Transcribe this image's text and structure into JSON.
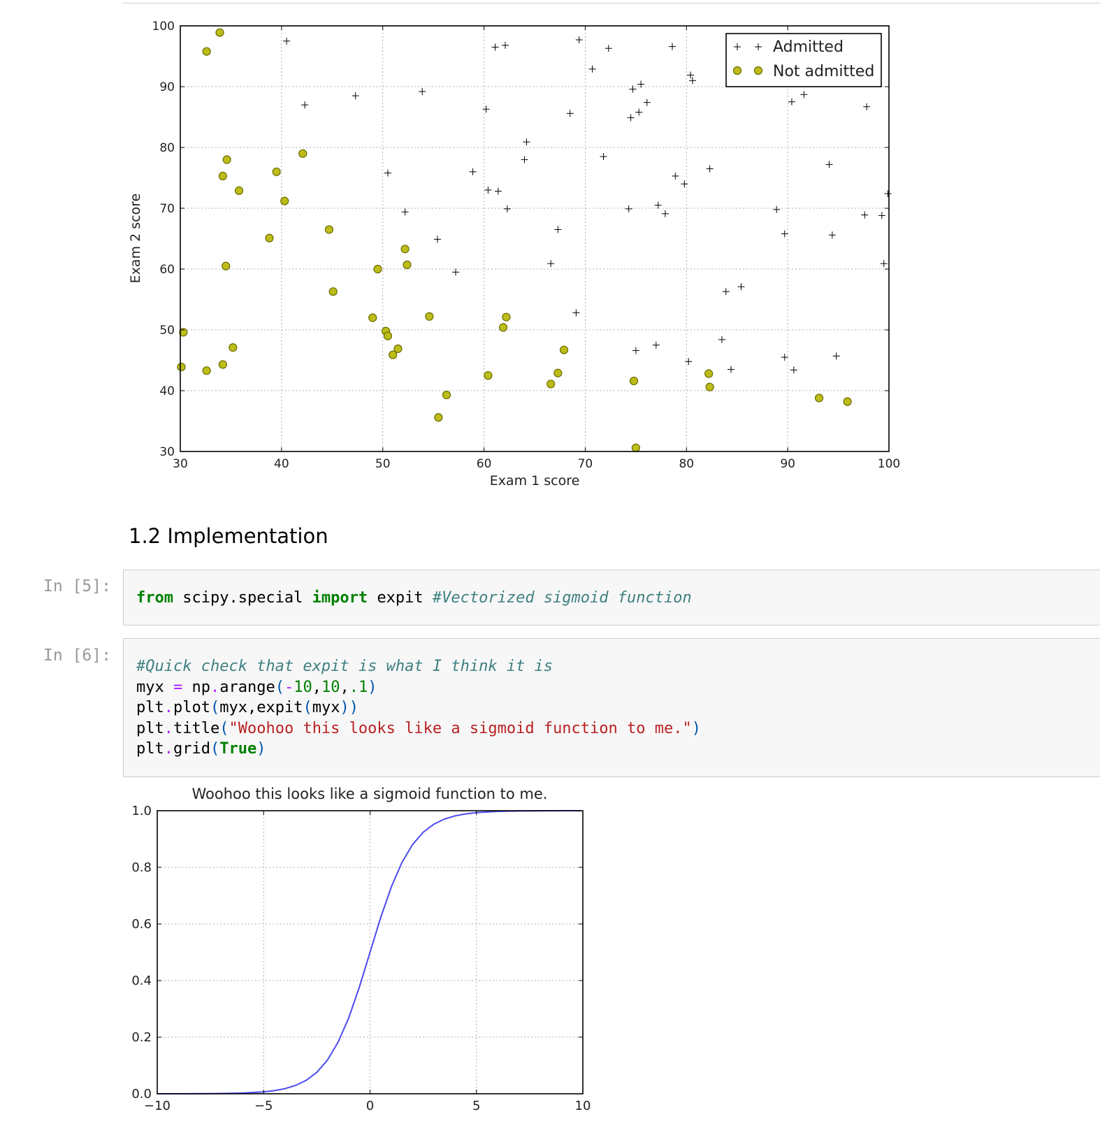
{
  "scatter": {
    "xlabel": "Exam 1 score",
    "ylabel": "Exam 2 score",
    "legend_admitted": "Admitted",
    "legend_not_admitted": "Not admitted",
    "xticks": [
      "30",
      "40",
      "50",
      "60",
      "70",
      "80",
      "90",
      "100"
    ],
    "yticks": [
      "30",
      "40",
      "50",
      "60",
      "70",
      "80",
      "90",
      "100"
    ]
  },
  "heading": "1.2 Implementation",
  "cell5": {
    "prompt": "In [5]:",
    "tokens": [
      {
        "t": "from",
        "c": "kw"
      },
      {
        "t": " scipy.special ",
        "c": ""
      },
      {
        "t": "import",
        "c": "kw"
      },
      {
        "t": " expit ",
        "c": ""
      },
      {
        "t": "#Vectorized sigmoid function",
        "c": "cm"
      }
    ]
  },
  "cell6": {
    "prompt": "In [6]:",
    "lines": [
      [
        {
          "t": "#Quick check that expit is what I think it is",
          "c": "cm"
        }
      ],
      [
        {
          "t": "myx ",
          "c": ""
        },
        {
          "t": "=",
          "c": "op"
        },
        {
          "t": " np",
          "c": ""
        },
        {
          "t": ".",
          "c": "op"
        },
        {
          "t": "arange",
          "c": ""
        },
        {
          "t": "(",
          "c": "par"
        },
        {
          "t": "-",
          "c": "op"
        },
        {
          "t": "10",
          "c": "num"
        },
        {
          "t": ",",
          "c": ""
        },
        {
          "t": "10",
          "c": "num"
        },
        {
          "t": ",",
          "c": ""
        },
        {
          "t": ".1",
          "c": "num"
        },
        {
          "t": ")",
          "c": "par"
        }
      ],
      [
        {
          "t": "plt",
          "c": ""
        },
        {
          "t": ".",
          "c": "op"
        },
        {
          "t": "plot",
          "c": ""
        },
        {
          "t": "(",
          "c": "par"
        },
        {
          "t": "myx,expit",
          "c": ""
        },
        {
          "t": "(",
          "c": "par"
        },
        {
          "t": "myx",
          "c": ""
        },
        {
          "t": "))",
          "c": "par"
        }
      ],
      [
        {
          "t": "plt",
          "c": ""
        },
        {
          "t": ".",
          "c": "op"
        },
        {
          "t": "title",
          "c": ""
        },
        {
          "t": "(",
          "c": "par"
        },
        {
          "t": "\"Woohoo this looks like a sigmoid function to me.\"",
          "c": "str"
        },
        {
          "t": ")",
          "c": "par"
        }
      ],
      [
        {
          "t": "plt",
          "c": ""
        },
        {
          "t": ".",
          "c": "op"
        },
        {
          "t": "grid",
          "c": ""
        },
        {
          "t": "(",
          "c": "par"
        },
        {
          "t": "True",
          "c": "kw"
        },
        {
          "t": ")",
          "c": "par"
        }
      ]
    ]
  },
  "colors": {
    "marker_fill": "#BDBD1A",
    "marker_edge": "#6B6B00",
    "line": "#4A4AF0",
    "grid": "#b0b0b0"
  },
  "chart_data": [
    {
      "type": "scatter",
      "title": "",
      "xlabel": "Exam 1 score",
      "ylabel": "Exam 2 score",
      "xlim": [
        30,
        100
      ],
      "ylim": [
        30,
        100
      ],
      "grid": true,
      "legend": "top-right",
      "series": [
        {
          "name": "Admitted",
          "marker": "plus",
          "points": [
            [
              40.5,
              97.5
            ],
            [
              42.3,
              87.0
            ],
            [
              47.3,
              88.5
            ],
            [
              50.5,
              75.8
            ],
            [
              52.2,
              69.4
            ],
            [
              53.9,
              89.2
            ],
            [
              55.4,
              64.9
            ],
            [
              57.2,
              59.5
            ],
            [
              58.9,
              76.0
            ],
            [
              60.2,
              86.3
            ],
            [
              60.4,
              73.0
            ],
            [
              61.1,
              96.5
            ],
            [
              61.4,
              72.8
            ],
            [
              62.1,
              96.8
            ],
            [
              62.3,
              69.9
            ],
            [
              64.0,
              78.0
            ],
            [
              64.2,
              80.9
            ],
            [
              66.6,
              60.9
            ],
            [
              67.3,
              66.5
            ],
            [
              68.5,
              85.6
            ],
            [
              69.1,
              52.8
            ],
            [
              69.4,
              97.7
            ],
            [
              70.7,
              92.9
            ],
            [
              71.8,
              78.5
            ],
            [
              72.3,
              96.3
            ],
            [
              74.3,
              69.9
            ],
            [
              74.5,
              84.9
            ],
            [
              74.7,
              89.6
            ],
            [
              75.0,
              46.6
            ],
            [
              75.3,
              85.8
            ],
            [
              75.5,
              90.4
            ],
            [
              76.1,
              87.4
            ],
            [
              77.0,
              47.5
            ],
            [
              77.2,
              70.5
            ],
            [
              77.9,
              69.1
            ],
            [
              78.6,
              96.6
            ],
            [
              78.9,
              75.3
            ],
            [
              79.8,
              74.0
            ],
            [
              80.2,
              44.8
            ],
            [
              80.4,
              91.9
            ],
            [
              80.6,
              91.0
            ],
            [
              82.3,
              76.5
            ],
            [
              83.5,
              48.4
            ],
            [
              83.9,
              56.3
            ],
            [
              84.4,
              43.5
            ],
            [
              85.4,
              57.1
            ],
            [
              88.9,
              69.8
            ],
            [
              89.7,
              45.5
            ],
            [
              89.7,
              65.8
            ],
            [
              90.4,
              87.5
            ],
            [
              90.6,
              43.4
            ],
            [
              91.6,
              88.7
            ],
            [
              94.1,
              77.2
            ],
            [
              94.4,
              65.6
            ],
            [
              94.8,
              45.7
            ],
            [
              97.6,
              68.9
            ],
            [
              97.8,
              86.7
            ],
            [
              99.3,
              68.8
            ],
            [
              99.5,
              60.9
            ],
            [
              99.9,
              72.4
            ]
          ]
        },
        {
          "name": "Not admitted",
          "marker": "circle",
          "points": [
            [
              30.1,
              43.9
            ],
            [
              30.3,
              49.6
            ],
            [
              32.6,
              43.3
            ],
            [
              32.6,
              95.8
            ],
            [
              33.9,
              98.9
            ],
            [
              34.2,
              44.3
            ],
            [
              34.2,
              75.3
            ],
            [
              34.5,
              60.5
            ],
            [
              34.6,
              78.0
            ],
            [
              35.2,
              47.1
            ],
            [
              35.8,
              72.9
            ],
            [
              38.8,
              65.1
            ],
            [
              39.5,
              76.0
            ],
            [
              40.3,
              71.2
            ],
            [
              42.1,
              79.0
            ],
            [
              44.7,
              66.5
            ],
            [
              45.1,
              56.3
            ],
            [
              49.0,
              52.0
            ],
            [
              49.5,
              60.0
            ],
            [
              50.3,
              49.8
            ],
            [
              50.5,
              49.0
            ],
            [
              51.0,
              45.9
            ],
            [
              51.5,
              46.9
            ],
            [
              52.2,
              63.3
            ],
            [
              52.4,
              60.7
            ],
            [
              54.6,
              52.2
            ],
            [
              55.5,
              35.6
            ],
            [
              56.3,
              39.3
            ],
            [
              60.4,
              42.5
            ],
            [
              61.9,
              50.4
            ],
            [
              62.2,
              52.1
            ],
            [
              66.6,
              41.1
            ],
            [
              67.3,
              42.9
            ],
            [
              67.9,
              46.7
            ],
            [
              74.8,
              41.6
            ],
            [
              75.0,
              30.6
            ],
            [
              82.2,
              42.8
            ],
            [
              82.3,
              40.6
            ],
            [
              93.1,
              38.8
            ],
            [
              95.9,
              38.2
            ]
          ]
        }
      ]
    },
    {
      "type": "line",
      "title": "Woohoo this looks like a sigmoid function to me.",
      "xlabel": "",
      "ylabel": "",
      "xlim": [
        -10,
        10
      ],
      "ylim": [
        0.0,
        1.0
      ],
      "xticks": [
        "−10",
        "−5",
        "0",
        "5",
        "10"
      ],
      "yticks": [
        "0.0",
        "0.2",
        "0.4",
        "0.6",
        "0.8",
        "1.0"
      ],
      "grid": true,
      "series": [
        {
          "x": [
            -10,
            -9,
            -8,
            -7,
            -6,
            -5,
            -4.5,
            -4,
            -3.5,
            -3,
            -2.5,
            -2,
            -1.5,
            -1,
            -0.5,
            0,
            0.5,
            1,
            1.5,
            2,
            2.5,
            3,
            3.5,
            4,
            4.5,
            5,
            6,
            7,
            8,
            9,
            9.9
          ],
          "y": [
            0.0,
            0.0001,
            0.0003,
            0.0009,
            0.0025,
            0.0067,
            0.011,
            0.018,
            0.0293,
            0.0474,
            0.0759,
            0.1192,
            0.1824,
            0.2689,
            0.3775,
            0.5,
            0.6225,
            0.7311,
            0.8176,
            0.8808,
            0.9241,
            0.9526,
            0.9707,
            0.982,
            0.989,
            0.9933,
            0.9975,
            0.9991,
            0.9997,
            0.9999,
            0.9999
          ]
        }
      ]
    }
  ]
}
